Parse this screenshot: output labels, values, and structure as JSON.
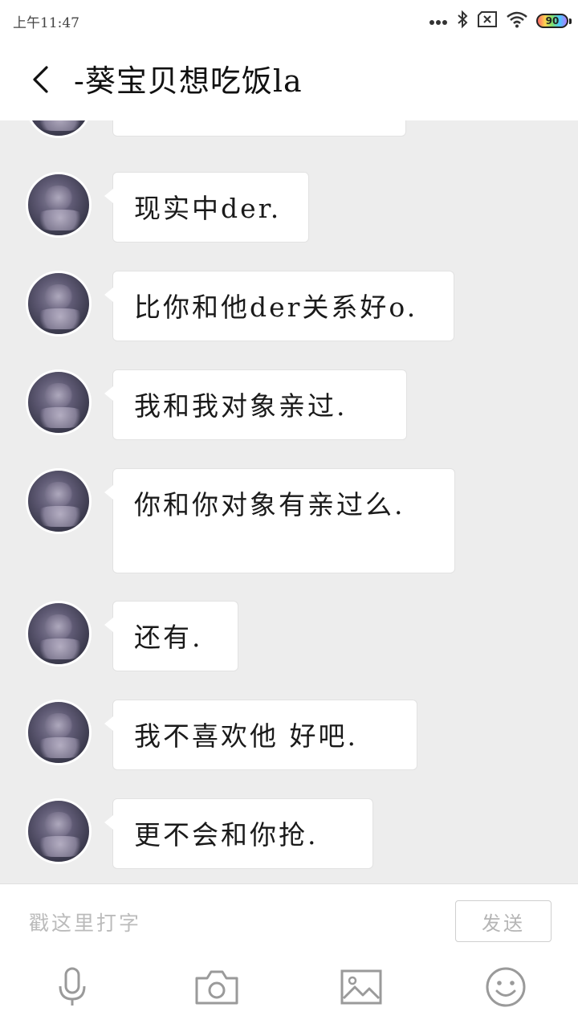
{
  "status_bar": {
    "time": "上午11:47",
    "battery": "90",
    "icons": [
      "more-dots-icon",
      "bluetooth-icon",
      "sim-none-icon",
      "wifi-icon",
      "battery-icon"
    ]
  },
  "header": {
    "back_icon": "chevron-left-icon",
    "title": "-葵宝贝想吃饭la"
  },
  "messages": [
    {
      "text": "现实中der."
    },
    {
      "text": "比你和他der关系好o."
    },
    {
      "text": "我和我对象亲过."
    },
    {
      "text": "你和你对象有亲过么."
    },
    {
      "text": "还有."
    },
    {
      "text": "我不喜欢他 好吧."
    },
    {
      "text": "更不会和你抢."
    }
  ],
  "composer": {
    "placeholder": "戳这里打字",
    "send_label": "发送",
    "tools": [
      "microphone-icon",
      "camera-icon",
      "image-icon",
      "emoji-icon"
    ]
  },
  "colors": {
    "chat_background": "#ededed",
    "bubble": "#ffffff",
    "icon_gray": "#9a9a9a"
  }
}
